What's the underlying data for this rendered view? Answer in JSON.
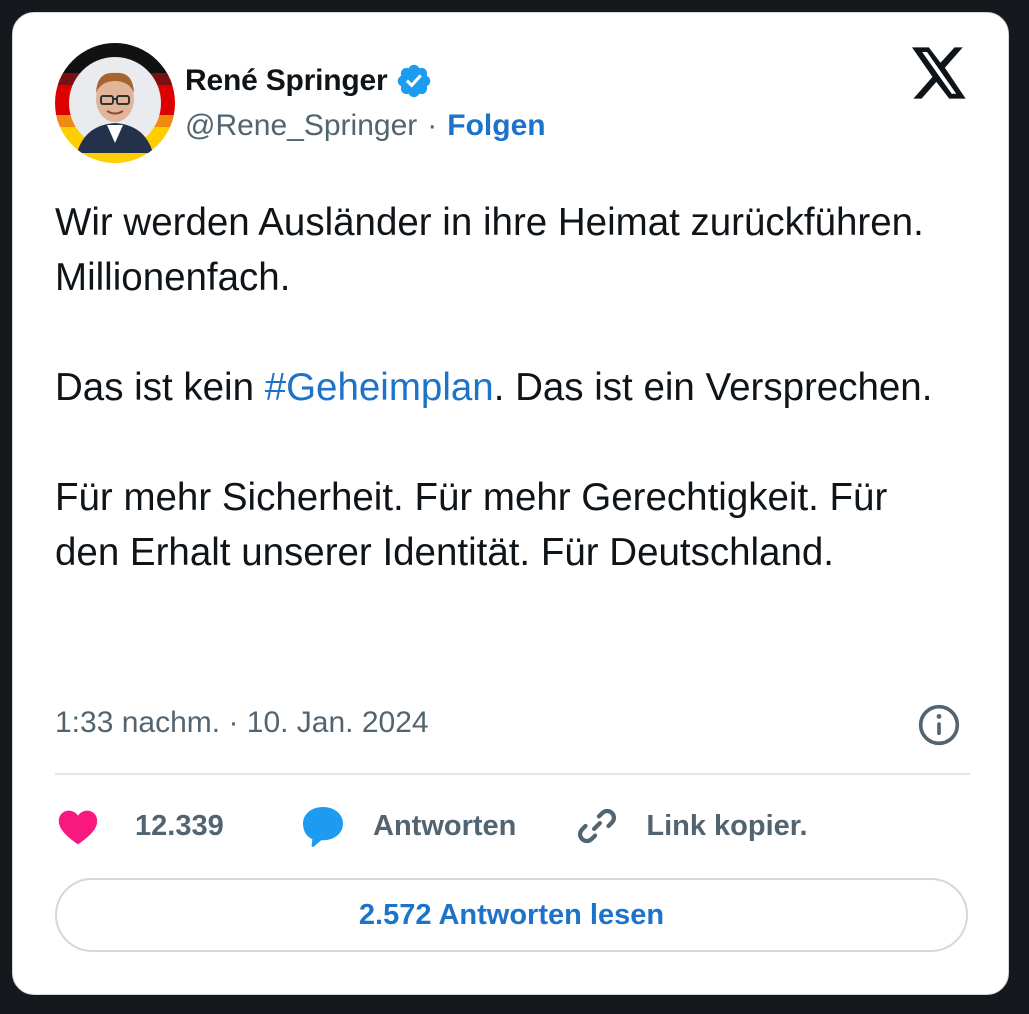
{
  "author": {
    "name": "René Springer",
    "handle": "@Rene_Springer",
    "separator": "·",
    "follow_label": "Folgen"
  },
  "tweet": {
    "para1": "Wir werden Ausländer in ihre Heimat zurückführen. Millionenfach.",
    "para2_before": "Das ist kein ",
    "para2_hashtag": "#Geheimplan",
    "para2_after": ". Das ist ein Versprechen.",
    "para3": "Für mehr Sicherheit. Für mehr Gerechtigkeit. Für den Erhalt unserer Identität. Für Deutschland."
  },
  "timestamp": "1:33 nachm. · 10. Jan. 2024",
  "actions": {
    "like_count": "12.339",
    "reply_label": "Antworten",
    "copy_label": "Link kopier."
  },
  "read_replies_label": "2.572 Antworten lesen",
  "icons": {
    "verified": "verified-badge-icon",
    "x_logo": "x-logo-icon",
    "info": "info-icon",
    "like": "heart-icon",
    "reply": "speech-bubble-icon",
    "copy": "link-icon"
  },
  "colors": {
    "accent": "#1d73c9",
    "like": "#f91880",
    "reply": "#1d9bf0",
    "muted": "#536471",
    "text": "#0f1419",
    "flag_black": "#000000",
    "flag_red": "#dd0000",
    "flag_gold": "#ffce00"
  }
}
